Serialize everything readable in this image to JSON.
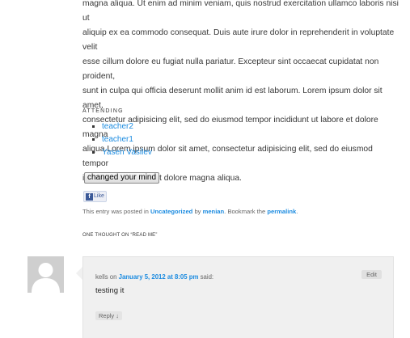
{
  "post": {
    "body_lines": [
      "magna aliqua. Ut enim ad minim veniam, quis nostrud exercitation ullamco laboris nisi ut",
      "aliquip ex ea commodo consequat. Duis aute irure dolor in reprehenderit in voluptate velit",
      "esse cillum dolore eu fugiat nulla pariatur. Excepteur sint occaecat cupidatat non proident,",
      "sunt in culpa qui officia deserunt mollit anim id est laborum. Lorem ipsum dolor sit amet,",
      "consectetur adipisicing elit, sed do eiusmod tempor incididunt ut labore et dolore magna",
      "aliqua.Lorem ipsum dolor sit amet, consectetur adipisicing elit, sed do eiusmod tempor",
      "incididunt ut labore et dolore magna aliqua."
    ]
  },
  "attending": {
    "label": "ATTENDING",
    "attendees": [
      "teacher2",
      "teacher1",
      "Yasen Vasilev"
    ],
    "button_label": "changed your mind"
  },
  "facebook": {
    "icon_letter": "f",
    "like_label": "Like"
  },
  "entry_meta": {
    "prefix": "This entry was posted in ",
    "category": "Uncategorized",
    "by": " by ",
    "author": "menian",
    "bookmark_text": ". Bookmark the ",
    "permalink_label": "permalink",
    "suffix": "."
  },
  "comments": {
    "title": "ONE THOUGHT ON “READ ME”",
    "items": [
      {
        "author": "kells",
        "on_text": " on ",
        "date": "January 5, 2012 at 8:05 pm",
        "said_text": " said:",
        "edit_label": "Edit",
        "text": "testing it",
        "reply_label": "Reply ↓"
      }
    ]
  },
  "colors": {
    "link": "#1b8be0",
    "text": "#373737",
    "comment_bg": "#f0f0f0",
    "avatar_bg": "#cfcfcf"
  },
  "icons": {
    "avatar": "default-avatar-silhouette-icon",
    "facebook": "facebook-icon"
  }
}
